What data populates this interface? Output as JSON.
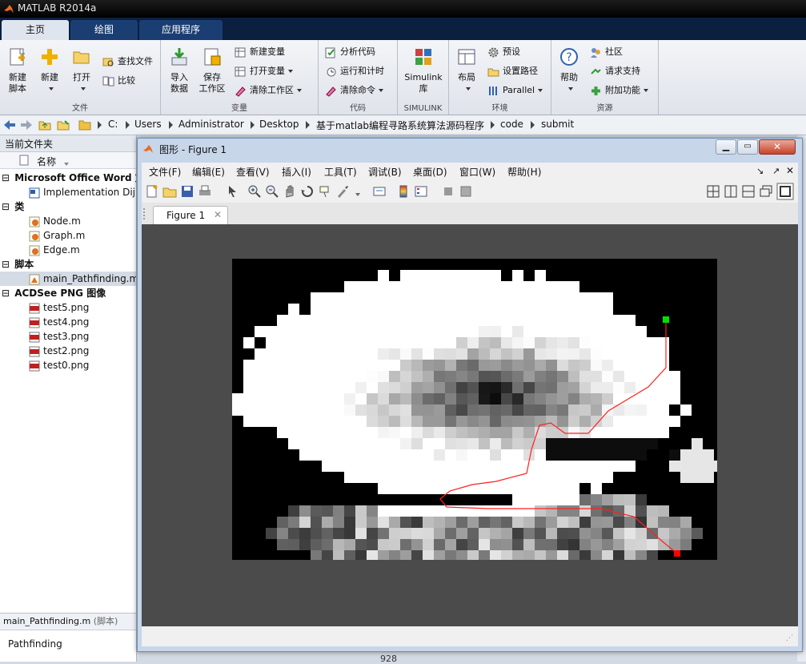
{
  "window": {
    "title": "MATLAB R2014a"
  },
  "tabs": [
    {
      "label": "主页",
      "active": true
    },
    {
      "label": "绘图",
      "active": false
    },
    {
      "label": "应用程序",
      "active": false
    }
  ],
  "ribbon": {
    "groups": {
      "file": "文件",
      "variable": "变量",
      "code": "代码",
      "simulink": "SIMULINK",
      "environment": "环境",
      "resources": "资源"
    },
    "new_script": [
      "新建",
      "脚本"
    ],
    "new": "新建",
    "open": "打开",
    "find_files": "查找文件",
    "compare": "比较",
    "import_data": [
      "导入",
      "数据"
    ],
    "save_workspace": [
      "保存",
      "工作区"
    ],
    "new_variable": "新建变量",
    "open_variable": "打开变量",
    "clear_workspace": "清除工作区",
    "analyze_code": "分析代码",
    "run_and_time": "运行和计时",
    "clear_commands": "清除命令",
    "simulink_library": [
      "Simulink",
      "库"
    ],
    "layout": "布局",
    "preferences": "预设",
    "set_path": "设置路径",
    "parallel": "Parallel",
    "help": "帮助",
    "community": "社区",
    "request_support": "请求支持",
    "add_ons": "附加功能"
  },
  "address": [
    "C:",
    "Users",
    "Administrator",
    "Desktop",
    "基于matlab编程寻路系统算法源码程序",
    "code",
    "submit"
  ],
  "current_folder": {
    "title": "当前文件夹",
    "column": "名称",
    "sections": [
      {
        "label": "Microsoft Office Word 文",
        "items": [
          "Implementation Dijl"
        ]
      },
      {
        "label": "类",
        "items": [
          "Node.m",
          "Graph.m",
          "Edge.m"
        ]
      },
      {
        "label": "脚本",
        "items": [
          "main_Pathfinding.m"
        ]
      },
      {
        "label": "ACDSee PNG 图像",
        "items": [
          "test5.png",
          "test4.png",
          "test3.png",
          "test2.png",
          "test0.png"
        ]
      }
    ],
    "details_file": "main_Pathfinding.m",
    "details_type": "(脚本)",
    "details_text": "Pathfinding"
  },
  "behind_text": "928",
  "figure": {
    "title": "图形 - Figure 1",
    "menu": [
      "文件(F)",
      "编辑(E)",
      "查看(V)",
      "插入(I)",
      "工具(T)",
      "调试(B)",
      "桌面(D)",
      "窗口(W)",
      "帮助(H)"
    ],
    "tab": "Figure 1",
    "start_color": "#00e000",
    "goal_color": "#ff0000",
    "path_color": "#ff2020"
  }
}
